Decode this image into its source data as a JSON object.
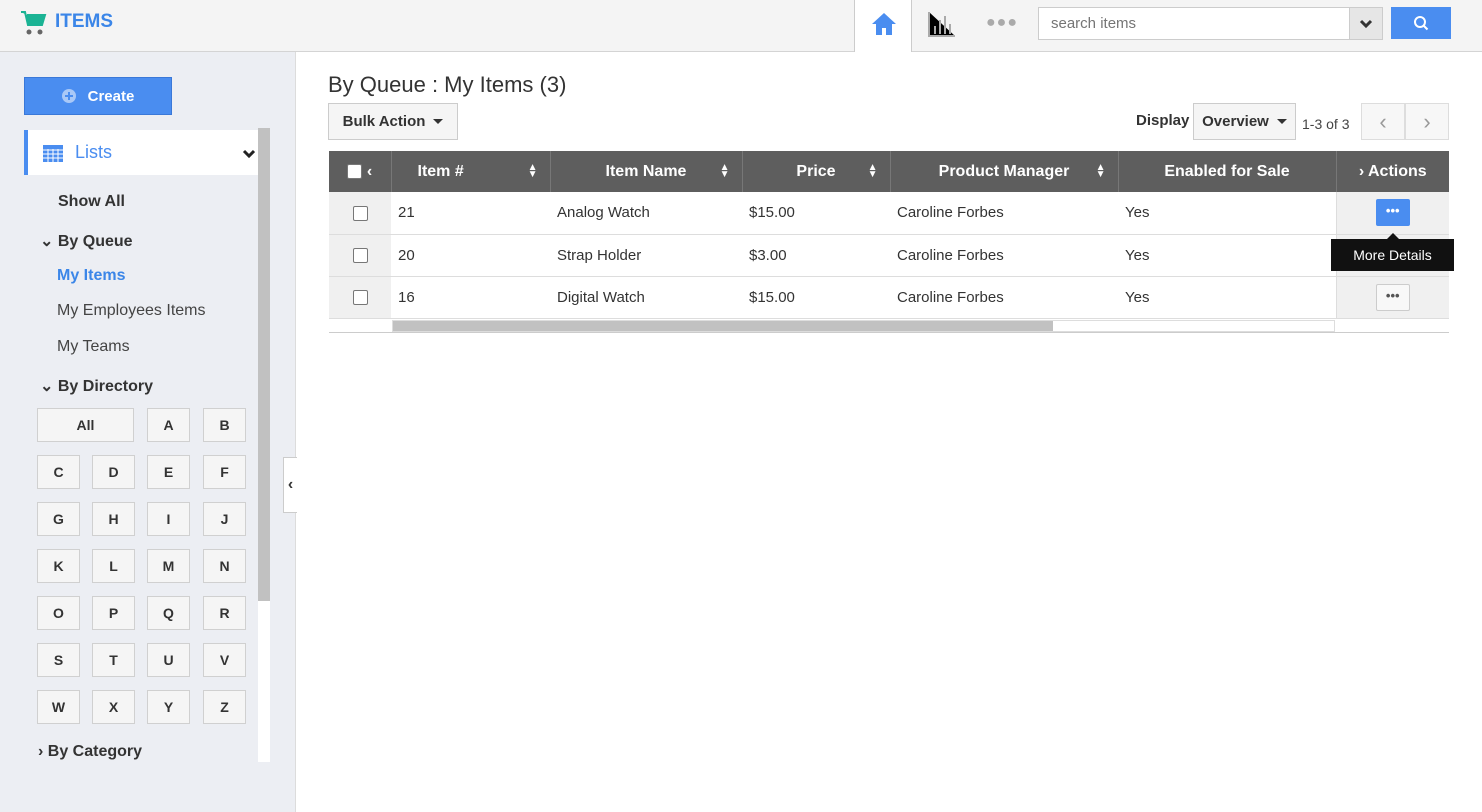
{
  "header": {
    "app_title": "ITEMS",
    "search_placeholder": "search items"
  },
  "sidebar": {
    "create_label": "Create",
    "lists_label": "Lists",
    "show_all": "Show All",
    "by_queue": "By Queue",
    "queue_items": [
      "My Items",
      "My Employees Items",
      "My Teams"
    ],
    "by_directory": "By Directory",
    "directory": [
      "All",
      "A",
      "B",
      "C",
      "D",
      "E",
      "F",
      "G",
      "H",
      "I",
      "J",
      "K",
      "L",
      "M",
      "N",
      "O",
      "P",
      "Q",
      "R",
      "S",
      "T",
      "U",
      "V",
      "W",
      "X",
      "Y",
      "Z"
    ],
    "by_category": "By Category"
  },
  "main": {
    "title": "By Queue : My Items (3)",
    "bulk_action": "Bulk Action",
    "display_label": "Display",
    "display_value": "Overview",
    "page_info": "1-3 of 3",
    "columns": [
      "Item #",
      "Item Name",
      "Price",
      "Product Manager",
      "Enabled for Sale",
      "Actions"
    ],
    "rows": [
      {
        "num": "21",
        "name": "Analog Watch",
        "price": "$15.00",
        "pm": "Caroline Forbes",
        "enabled": "Yes"
      },
      {
        "num": "20",
        "name": "Strap Holder",
        "price": "$3.00",
        "pm": "Caroline Forbes",
        "enabled": "Yes"
      },
      {
        "num": "16",
        "name": "Digital Watch",
        "price": "$15.00",
        "pm": "Caroline Forbes",
        "enabled": "Yes"
      }
    ],
    "more_label": "•••",
    "tooltip": "More Details"
  }
}
